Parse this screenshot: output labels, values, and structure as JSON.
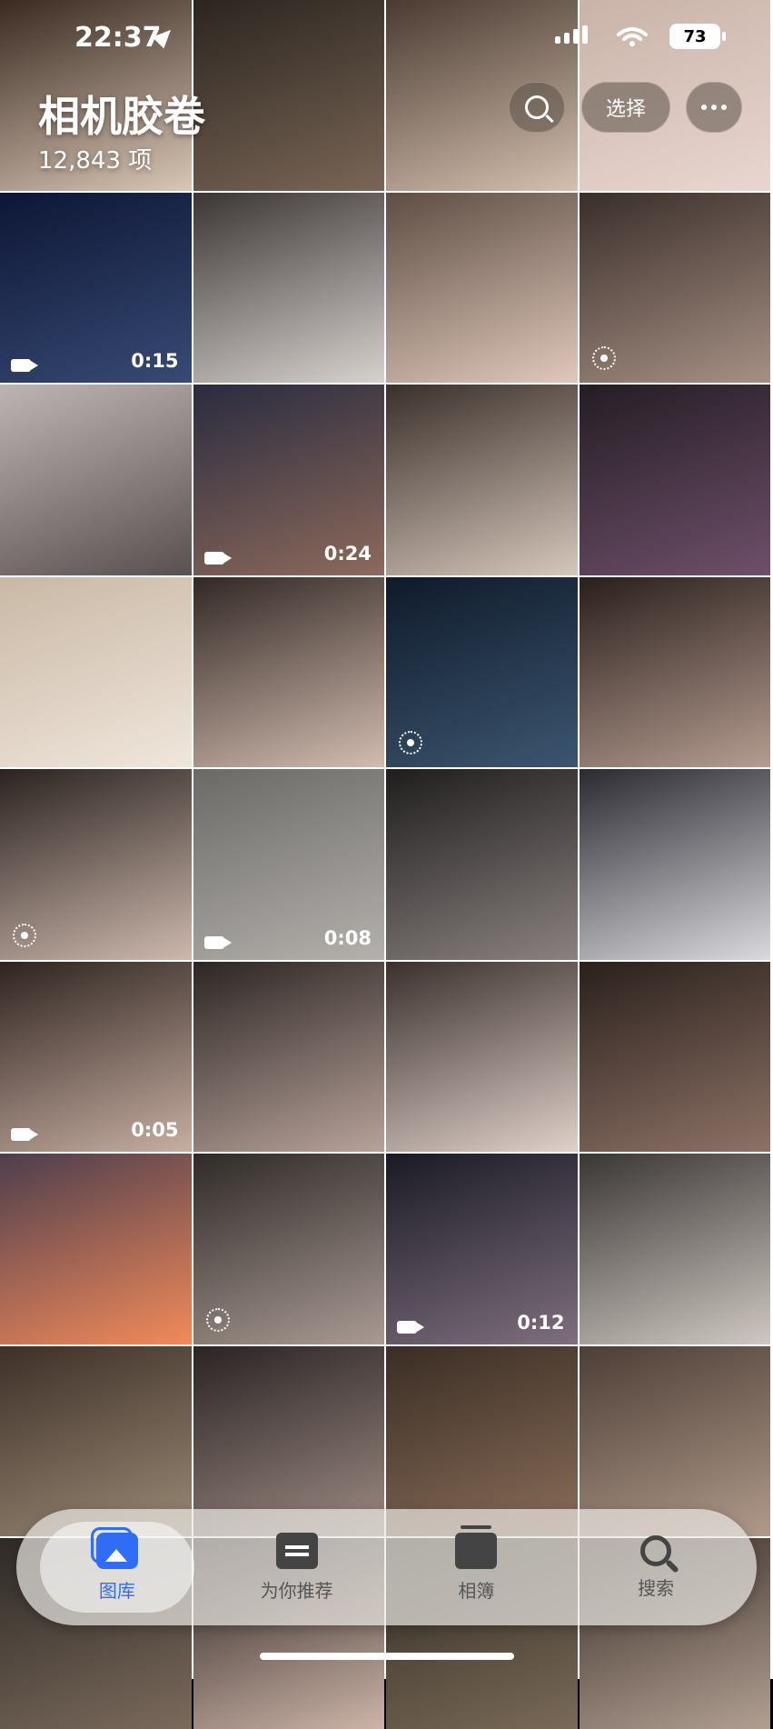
{
  "status": {
    "time": "22:37",
    "battery": "73"
  },
  "header": {
    "title": "相机胶卷",
    "count": "12,843 项",
    "select_label": "选择"
  },
  "tiles": [
    {
      "c1": "#3a2a20",
      "c2": "#d8c6b6"
    },
    {
      "c1": "#2b2520",
      "c2": "#7a6656"
    },
    {
      "c1": "#4a3a30",
      "c2": "#d4c0b0"
    },
    {
      "c1": "#c9b3a8",
      "c2": "#e9d6d0"
    },
    {
      "c1": "#0d1635",
      "c2": "#384a74",
      "type": "video",
      "duration": "0:15"
    },
    {
      "c1": "#3b3634",
      "c2": "#d8d2cf"
    },
    {
      "c1": "#5e4d43",
      "c2": "#e0c8bb"
    },
    {
      "c1": "#3a2e2a",
      "c2": "#a69084",
      "type": "live"
    },
    {
      "c1": "#bdb5b3",
      "c2": "#5a5050"
    },
    {
      "c1": "#2a2b3f",
      "c2": "#8d6a5c",
      "type": "video",
      "duration": "0:24"
    },
    {
      "c1": "#3a2f2a",
      "c2": "#d6c7bb"
    },
    {
      "c1": "#241d24",
      "c2": "#6f4f6a"
    },
    {
      "c1": "#c9b8a5",
      "c2": "#f0e6dc"
    },
    {
      "c1": "#322824",
      "c2": "#d2bcb0"
    },
    {
      "c1": "#0f1a2a",
      "c2": "#3c5670",
      "type": "live"
    },
    {
      "c1": "#2a1f1c",
      "c2": "#b59c90"
    },
    {
      "c1": "#2b2320",
      "c2": "#cdb8ad",
      "type": "live"
    },
    {
      "c1": "#6b6966",
      "c2": "#b4b1ad",
      "type": "video",
      "duration": "0:08"
    },
    {
      "c1": "#1f1d1d",
      "c2": "#8a8280"
    },
    {
      "c1": "#2a2a30",
      "c2": "#d9d9de"
    },
    {
      "c1": "#2f2420",
      "c2": "#c7aea2",
      "type": "video",
      "duration": "0:05"
    },
    {
      "c1": "#2c2624",
      "c2": "#b8a29a"
    },
    {
      "c1": "#3a302d",
      "c2": "#e0d0c9"
    },
    {
      "c1": "#2a201c",
      "c2": "#8d7266"
    },
    {
      "c1": "#4d3e4d",
      "c2": "#f28a5a"
    },
    {
      "c1": "#2f2a28",
      "c2": "#a99a93",
      "type": "live"
    },
    {
      "c1": "#1a1a24",
      "c2": "#7f6f7e",
      "type": "video",
      "duration": "0:12"
    },
    {
      "c1": "#3a3634",
      "c2": "#cfc8c2"
    },
    {
      "c1": "#3e3028",
      "c2": "#9a8a76"
    },
    {
      "c1": "#2a2424",
      "c2": "#9e8b84"
    },
    {
      "c1": "#3a2d24",
      "c2": "#8a6e5a"
    },
    {
      "c1": "#4d3e36",
      "c2": "#b09a8a"
    },
    {
      "c1": "#2e2a26",
      "c2": "#7b6a5c"
    },
    {
      "c1": "#2a2220",
      "c2": "#cdb4a8"
    },
    {
      "c1": "#2f2a22",
      "c2": "#7a6a58"
    },
    {
      "c1": "#3a2e28",
      "c2": "#b19f92"
    }
  ],
  "tabbar": {
    "tabs": [
      {
        "label": "图库",
        "icon": "photos-icon"
      },
      {
        "label": "为你推荐",
        "icon": "for-you-icon"
      },
      {
        "label": "相簿",
        "icon": "albums-icon"
      },
      {
        "label": "搜索",
        "icon": "search-icon"
      }
    ],
    "active_color": "#2f6df6"
  }
}
